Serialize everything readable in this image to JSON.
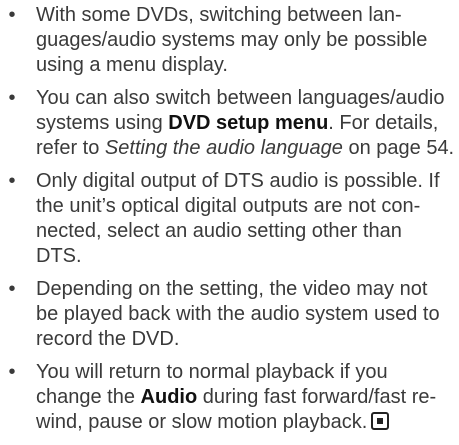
{
  "bullet_glyph": "•",
  "notes": [
    {
      "lines": [
        "With some DVDs, switching between lan-",
        "guages/audio systems may only be possible",
        "using a menu display."
      ]
    },
    {
      "line1": "You can also switch between languages/audio",
      "line2_pre": "systems using ",
      "line2_bold": "DVD setup menu",
      "line2_post": ". For details,",
      "line3_pre": "refer to ",
      "line3_italic": "Setting the audio language",
      "line3_post": " on page 54."
    },
    {
      "lines": [
        "Only digital output of DTS audio is possible. If",
        "the unit’s optical digital outputs are not con-",
        "nected, select an audio setting other than",
        "DTS."
      ]
    },
    {
      "lines": [
        "Depending on the setting, the video may not",
        "be played back with the audio system used to",
        "record the DVD."
      ]
    },
    {
      "line1": "You will return to normal playback if you",
      "line2_pre": "change the ",
      "line2_bold": "Audio",
      "line2_post": " during fast forward/fast re-",
      "line3": "wind, pause or slow motion playback.",
      "end_icon": "stop-icon"
    }
  ]
}
